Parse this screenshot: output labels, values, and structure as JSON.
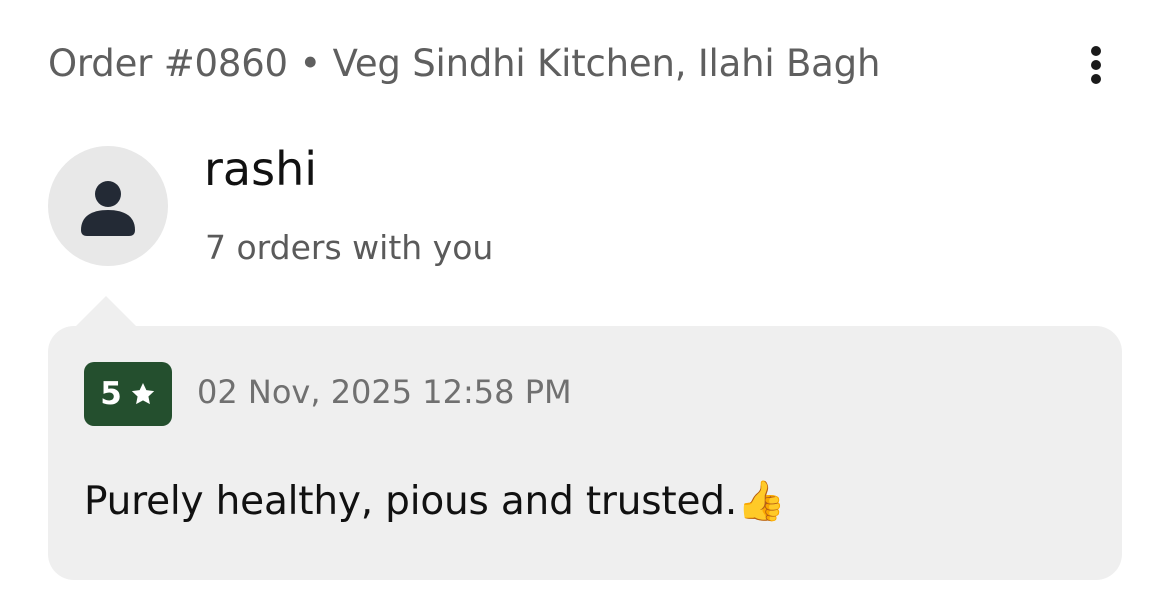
{
  "header": {
    "order_title": "Order #0860 • Veg Sindhi Kitchen, Ilahi Bagh",
    "more_icon": "more-vertical-icon"
  },
  "customer": {
    "avatar_icon": "person-icon",
    "name": "rashi",
    "orders_text": "7 orders with you"
  },
  "review": {
    "rating": "5",
    "star_icon": "star-icon",
    "date": "02 Nov, 2025 12:58 PM",
    "text": "Purely healthy, pious and trusted.👍"
  },
  "colors": {
    "badge_green": "#244f2e",
    "card_background": "#efefef",
    "avatar_background": "#e8e8e8"
  }
}
